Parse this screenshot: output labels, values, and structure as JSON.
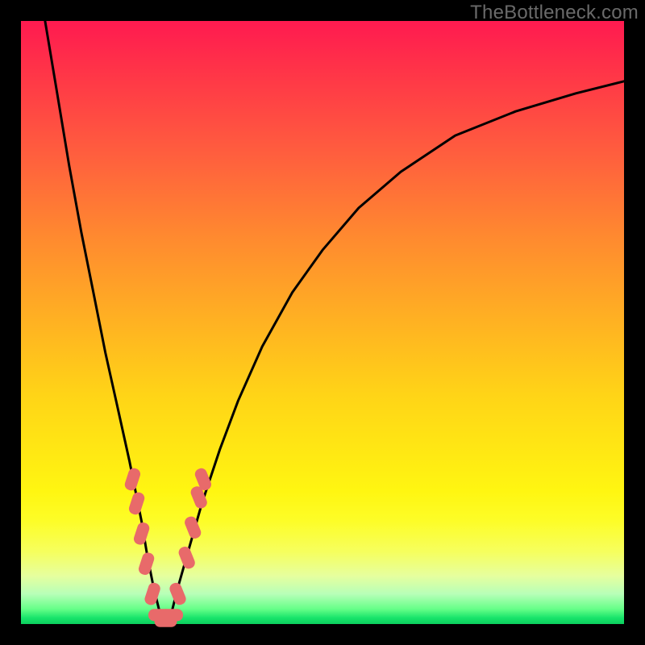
{
  "watermark": "TheBottleneck.com",
  "chart_data": {
    "type": "line",
    "title": "",
    "xlabel": "",
    "ylabel": "",
    "xlim": [
      0,
      100
    ],
    "ylim": [
      0,
      100
    ],
    "series": [
      {
        "name": "bottleneck-curve",
        "x": [
          4,
          6,
          8,
          10,
          12,
          14,
          16,
          18,
          19,
          20,
          21,
          22,
          23,
          24,
          25,
          26,
          28,
          30,
          33,
          36,
          40,
          45,
          50,
          56,
          63,
          72,
          82,
          92,
          100
        ],
        "y": [
          100,
          88,
          76,
          65,
          55,
          45,
          36,
          27,
          22,
          17,
          11,
          6,
          2,
          0,
          2,
          6,
          13,
          20,
          29,
          37,
          46,
          55,
          62,
          69,
          75,
          81,
          85,
          88,
          90
        ]
      }
    ],
    "markers": {
      "name": "highlighted-points",
      "color": "#e86a6a",
      "points": [
        {
          "x": 18.5,
          "y": 24
        },
        {
          "x": 19.2,
          "y": 20
        },
        {
          "x": 20.0,
          "y": 15
        },
        {
          "x": 20.8,
          "y": 10
        },
        {
          "x": 21.8,
          "y": 5
        },
        {
          "x": 23.0,
          "y": 1.5
        },
        {
          "x": 24.0,
          "y": 0.5
        },
        {
          "x": 25.0,
          "y": 1.5
        },
        {
          "x": 26.0,
          "y": 5
        },
        {
          "x": 27.5,
          "y": 11
        },
        {
          "x": 28.5,
          "y": 16
        },
        {
          "x": 29.5,
          "y": 21
        },
        {
          "x": 30.2,
          "y": 24
        }
      ]
    }
  }
}
